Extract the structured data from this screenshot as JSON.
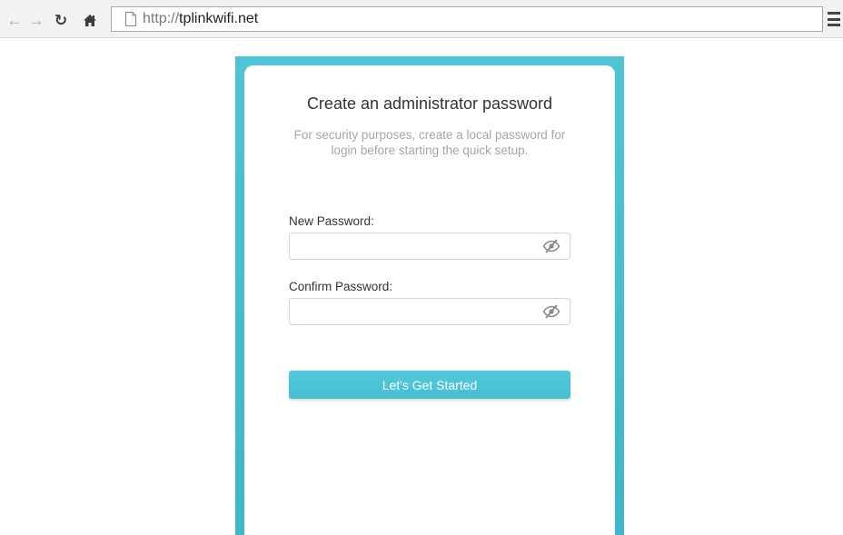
{
  "browser": {
    "url_scheme": "http://",
    "url_host": "tplinkwifi.net",
    "icons": {
      "back": "arrow-left-icon",
      "forward": "arrow-right-icon",
      "reload": "reload-icon",
      "home": "home-icon",
      "page": "page-icon",
      "menu": "hamburger-menu-icon"
    }
  },
  "setup": {
    "title": "Create an administrator password",
    "subtitle": "For security purposes, create a local password for login before starting the quick setup.",
    "new_password": {
      "label": "New Password:",
      "value": "",
      "toggle_icon": "eye-slash-icon"
    },
    "confirm_password": {
      "label": "Confirm Password:",
      "value": "",
      "toggle_icon": "eye-slash-icon"
    },
    "submit_label": "Let's Get Started"
  },
  "colors": {
    "frame": "#4cc1d3",
    "button": "#4cc4d8",
    "subtitle_text": "#a6a6a6"
  }
}
